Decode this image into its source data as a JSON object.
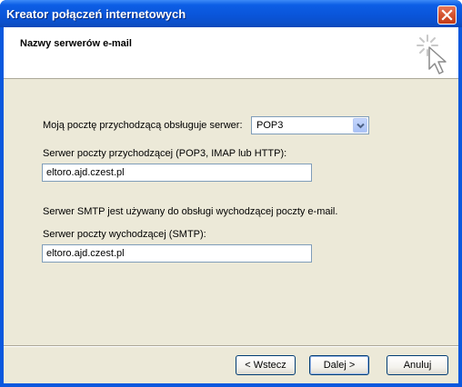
{
  "window": {
    "title": "Kreator połączeń internetowych"
  },
  "header": {
    "title": "Nazwy serwerów e-mail"
  },
  "form": {
    "incoming_type_label": "Moją pocztę przychodzącą obsługuje serwer:",
    "incoming_type_value": "POP3",
    "incoming_server_label": "Serwer poczty przychodzącej (POP3, IMAP lub HTTP):",
    "incoming_server_value": "eltoro.ajd.czest.pl",
    "smtp_note": "Serwer SMTP jest używany do obsługi wychodzącej poczty e-mail.",
    "outgoing_server_label": "Serwer poczty wychodzącej (SMTP):",
    "outgoing_server_value": "eltoro.ajd.czest.pl"
  },
  "buttons": {
    "back": "< Wstecz",
    "next": "Dalej >",
    "cancel": "Anuluj"
  },
  "icons": {
    "close": "close-icon",
    "wizard": "wizard-cursor-icon",
    "dropdown": "chevron-down-icon"
  },
  "colors": {
    "titlebar": "#0a54d8",
    "client_bg": "#ece9d8",
    "close_button": "#d4532f",
    "field_border": "#7f9db9"
  }
}
